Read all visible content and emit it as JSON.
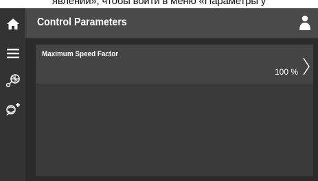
{
  "caption": "явлений», чтобы войти в меню «Параметры у",
  "header": {
    "title": "Control Parameters"
  },
  "icons": {
    "home": "home-icon",
    "menu": "hamburger-menu-icon",
    "speed": "fan-speed-icon",
    "fan_add": "fan-plus-icon",
    "user": "user-icon",
    "chevron": "chevron-right-icon"
  },
  "parameters": [
    {
      "label": "Maximum Speed Factor",
      "value": "100 %"
    }
  ],
  "colors": {
    "sidebar": "#333333",
    "header": "#4a4a4a",
    "panel": "#3a3a3a",
    "row": "#444444",
    "text": "#ffffff"
  }
}
